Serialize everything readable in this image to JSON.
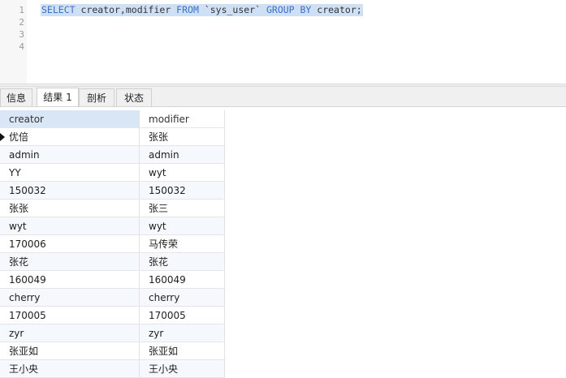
{
  "editor": {
    "line_numbers": [
      "1",
      "2",
      "3",
      "4"
    ],
    "sql": {
      "kw_select": "SELECT",
      "cols": " creator,modifier ",
      "kw_from": "FROM",
      "table": " `sys_user` ",
      "kw_group": "GROUP BY",
      "tail": " creator;"
    }
  },
  "tabs": [
    "信息",
    "结果 1",
    "剖析",
    "状态"
  ],
  "active_tab": "结果 1",
  "grid": {
    "columns": [
      "creator",
      "modifier"
    ],
    "rows": [
      [
        "优倍",
        "张张"
      ],
      [
        "admin",
        "admin"
      ],
      [
        "YY",
        "wyt"
      ],
      [
        "150032",
        "150032"
      ],
      [
        "张张",
        "张三"
      ],
      [
        "wyt",
        "wyt"
      ],
      [
        "170006",
        "马传荣"
      ],
      [
        "张花",
        "张花"
      ],
      [
        "160049",
        "160049"
      ],
      [
        "cherry",
        "cherry"
      ],
      [
        "170005",
        "170005"
      ],
      [
        "zyr",
        "zyr"
      ],
      [
        "张亚如",
        "张亚如"
      ],
      [
        "王小央",
        "王小央"
      ]
    ],
    "current_row_marker": "row-pointer-icon"
  },
  "colors": {
    "keyword": "#3b6fc9",
    "selection": "#cfe0f4",
    "header_selected": "#d9e6f6"
  }
}
